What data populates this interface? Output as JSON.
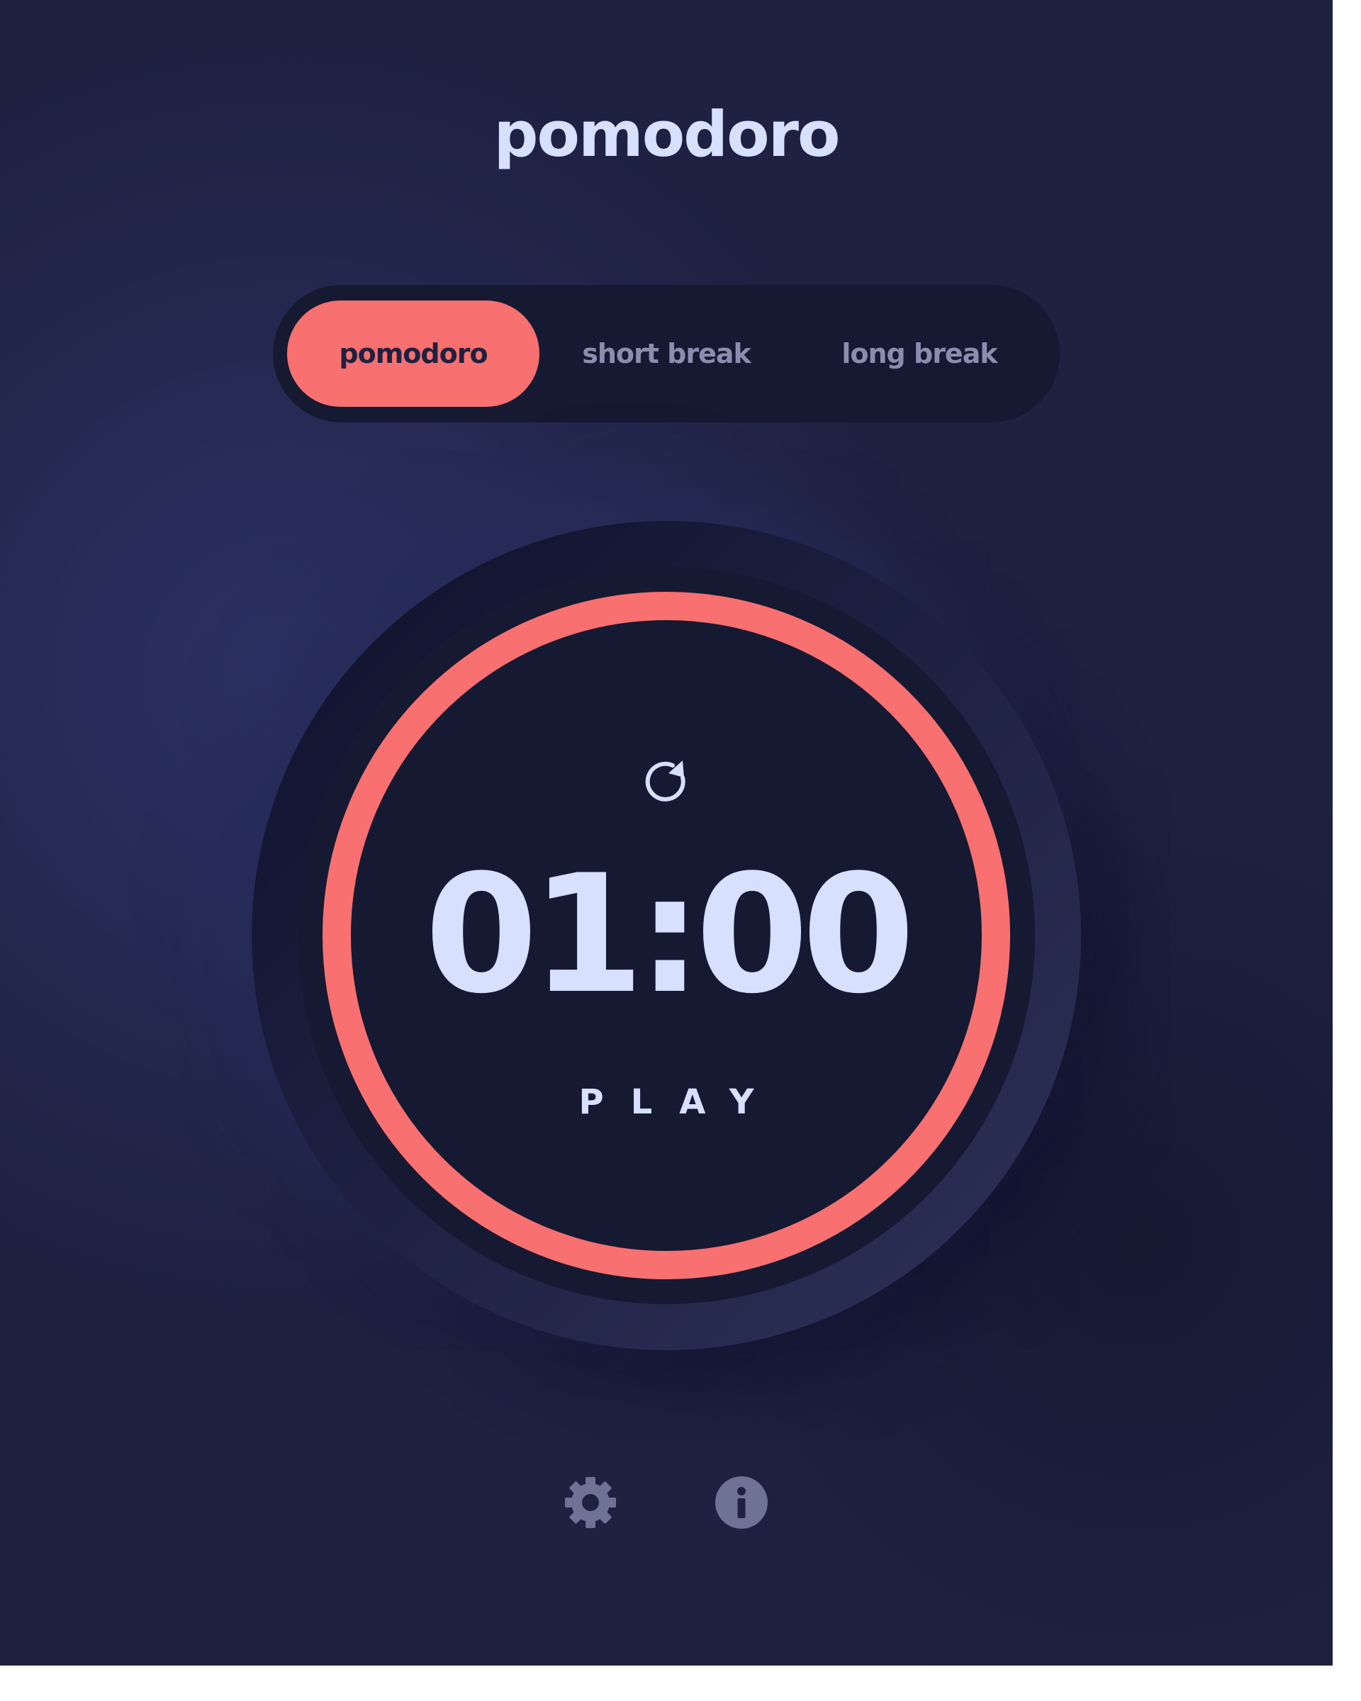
{
  "app": {
    "title": "pomodoro"
  },
  "modes": [
    {
      "label": "pomodoro",
      "active": true
    },
    {
      "label": "short break",
      "active": false
    },
    {
      "label": "long break",
      "active": false
    }
  ],
  "timer": {
    "time": "01:00",
    "action_label": "PLAY",
    "progress": 1.0,
    "accent_color": "#f87070"
  },
  "icons": {
    "reset": "reset-icon",
    "settings": "gear-icon",
    "info": "info-icon"
  },
  "colors": {
    "background": "#1e2140",
    "panel": "#161932",
    "accent": "#f87070",
    "text": "#d7e0ff",
    "muted": "#8a8eae"
  }
}
